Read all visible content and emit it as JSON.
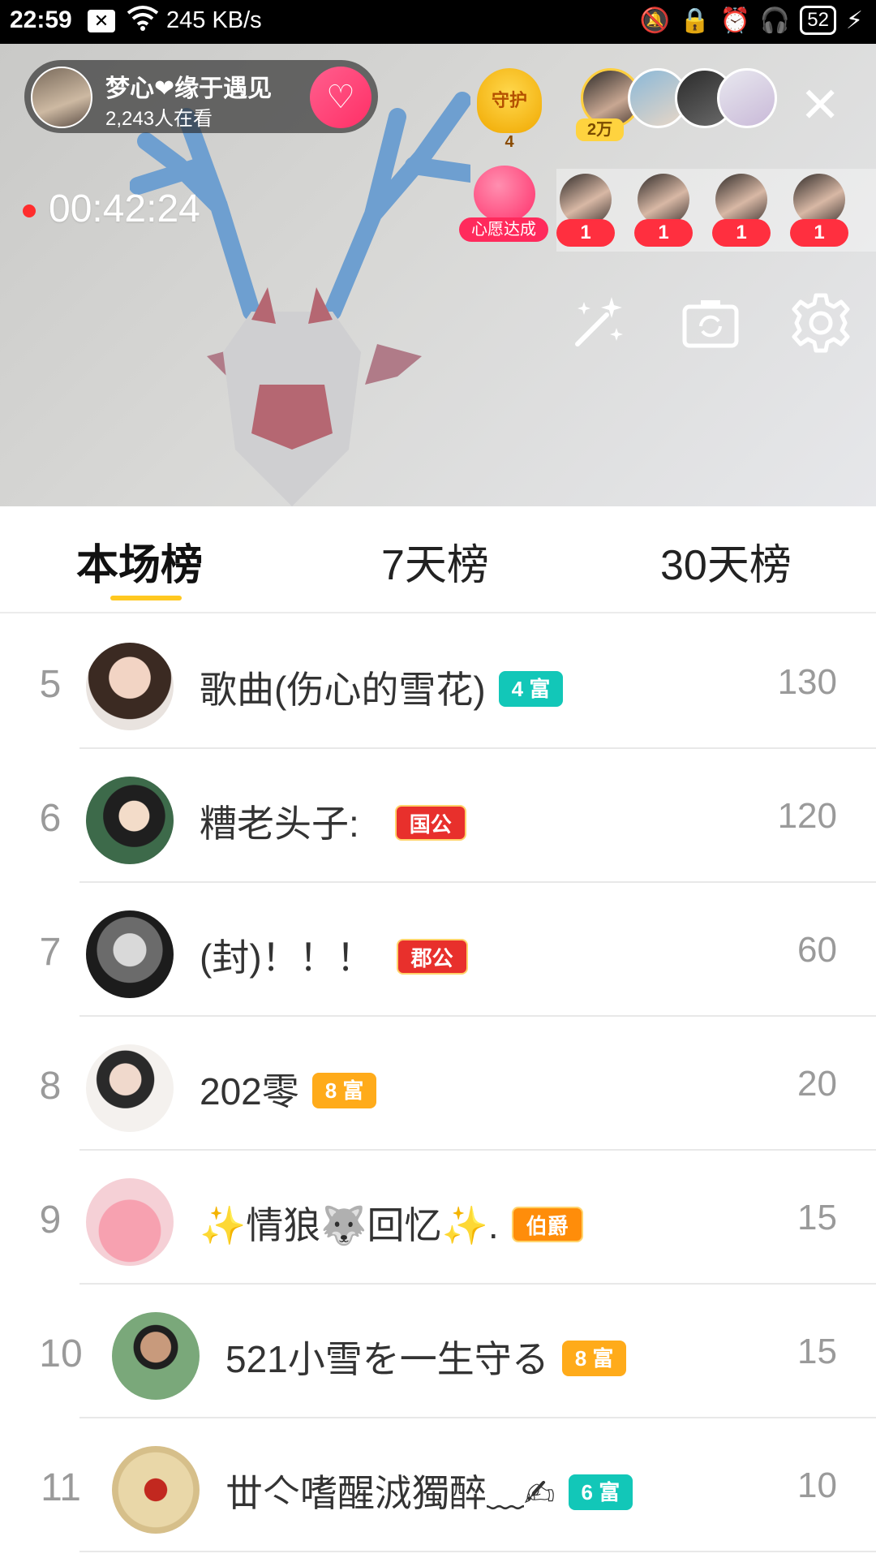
{
  "status_bar": {
    "time": "22:59",
    "notification_icon": "close-box-icon",
    "speed": "245 KB/s",
    "battery": "52"
  },
  "live": {
    "host": {
      "name": "梦心❤缘于遇见",
      "viewers": "2,243人在看",
      "follow_icon": "heart-plus-icon"
    },
    "guard": {
      "label": "守护",
      "count": "4"
    },
    "top_viewers_count": "2万",
    "timer": "00:42:24",
    "wish": {
      "label": "心愿达成"
    },
    "wish_gifts": [
      "1",
      "1",
      "1",
      "1"
    ],
    "tools": [
      "magic-wand-icon",
      "camera-flip-icon",
      "gear-icon"
    ]
  },
  "tabs": [
    {
      "label": "本场榜",
      "active": true
    },
    {
      "label": "7天榜",
      "active": false
    },
    {
      "label": "30天榜",
      "active": false
    }
  ],
  "ranking": [
    {
      "rank": "5",
      "name": "歌曲(伤心的雪花)",
      "badge": "4 富",
      "score": "130"
    },
    {
      "rank": "6",
      "name": "糟老头子:",
      "badge": "国公",
      "score": "120"
    },
    {
      "rank": "7",
      "name": "(封)！！！",
      "badge": "郡公",
      "score": "60"
    },
    {
      "rank": "8",
      "name": "202零",
      "badge": "8 富",
      "score": "20"
    },
    {
      "rank": "9",
      "name": "✨情狼🐺回忆✨.",
      "badge": "伯爵",
      "score": "15"
    },
    {
      "rank": "10",
      "name": "521小雪を一生守る",
      "badge": "8 富",
      "score": "15"
    },
    {
      "rank": "11",
      "name": "丗亽嗜醒㳚獨醉﹏✍",
      "badge": "6 富",
      "score": "10"
    }
  ],
  "colors": {
    "accent_yellow": "#ffc820",
    "badge_teal": "#12c7b8",
    "badge_orange": "#ffab1a",
    "badge_red": "#e8302c",
    "follow_pink": "#ff2f66"
  }
}
